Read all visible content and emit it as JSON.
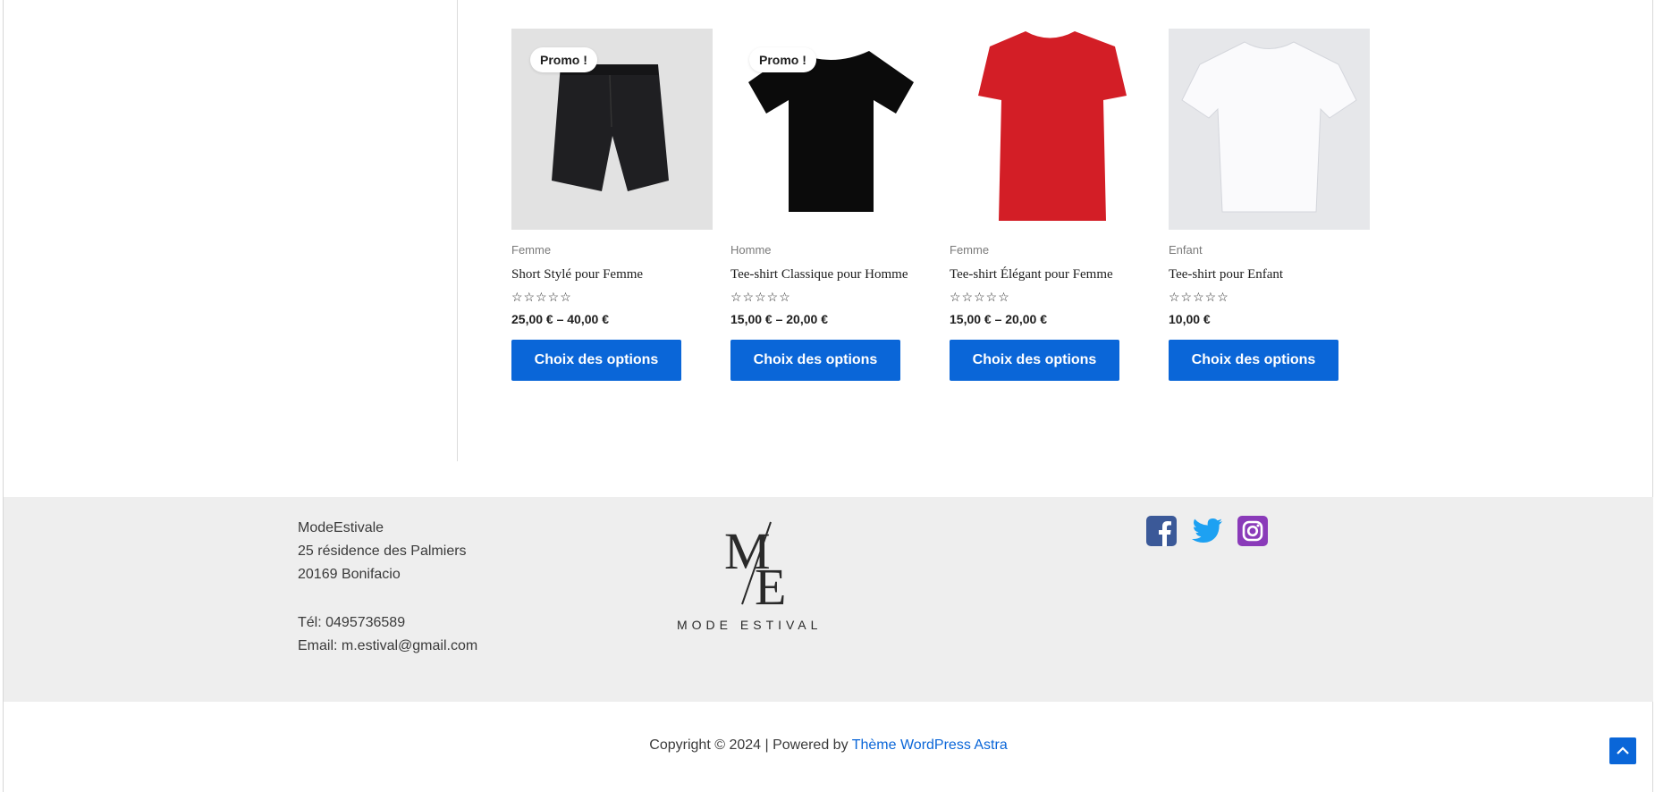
{
  "products": [
    {
      "category": "Femme",
      "name": "Short Stylé pour Femme",
      "rating_stars": "☆☆☆☆☆",
      "price": "25,00 € – 40,00 €",
      "button": "Choix des options",
      "promo": "Promo !",
      "image": "black-shorts"
    },
    {
      "category": "Homme",
      "name": "Tee-shirt Classique pour Homme",
      "rating_stars": "☆☆☆☆☆",
      "price": "15,00 € – 20,00 €",
      "button": "Choix des options",
      "promo": "Promo !",
      "image": "black-tshirt"
    },
    {
      "category": "Femme",
      "name": "Tee-shirt Élégant pour Femme",
      "rating_stars": "☆☆☆☆☆",
      "price": "15,00 € – 20,00 €",
      "button": "Choix des options",
      "promo": "",
      "image": "red-tshirt"
    },
    {
      "category": "Enfant",
      "name": "Tee-shirt pour Enfant",
      "rating_stars": "☆☆☆☆☆",
      "price": "10,00 €",
      "button": "Choix des options",
      "promo": "",
      "image": "white-tshirt"
    }
  ],
  "footer": {
    "address": {
      "company": "ModeEstivale",
      "street": "25 résidence des Palmiers",
      "city": "20169 Bonifacio",
      "phone": "Tél: 0495736589",
      "email": "Email: m.estival@gmail.com"
    },
    "logo": {
      "monogram_top": "M",
      "monogram_bottom": "E",
      "tagline": "MODE ESTIVAL"
    },
    "socials": [
      {
        "name": "facebook-icon",
        "color": "#3b5998"
      },
      {
        "name": "twitter-icon",
        "color": "#1da1f2"
      },
      {
        "name": "instagram-icon",
        "color": "#8a3ab9"
      }
    ],
    "copyright_prefix": "Copyright © 2024 | Powered by ",
    "copyright_link": "Thème WordPress Astra"
  },
  "colors": {
    "accent": "#0a66d8",
    "footer_bg": "#eeeeee"
  }
}
